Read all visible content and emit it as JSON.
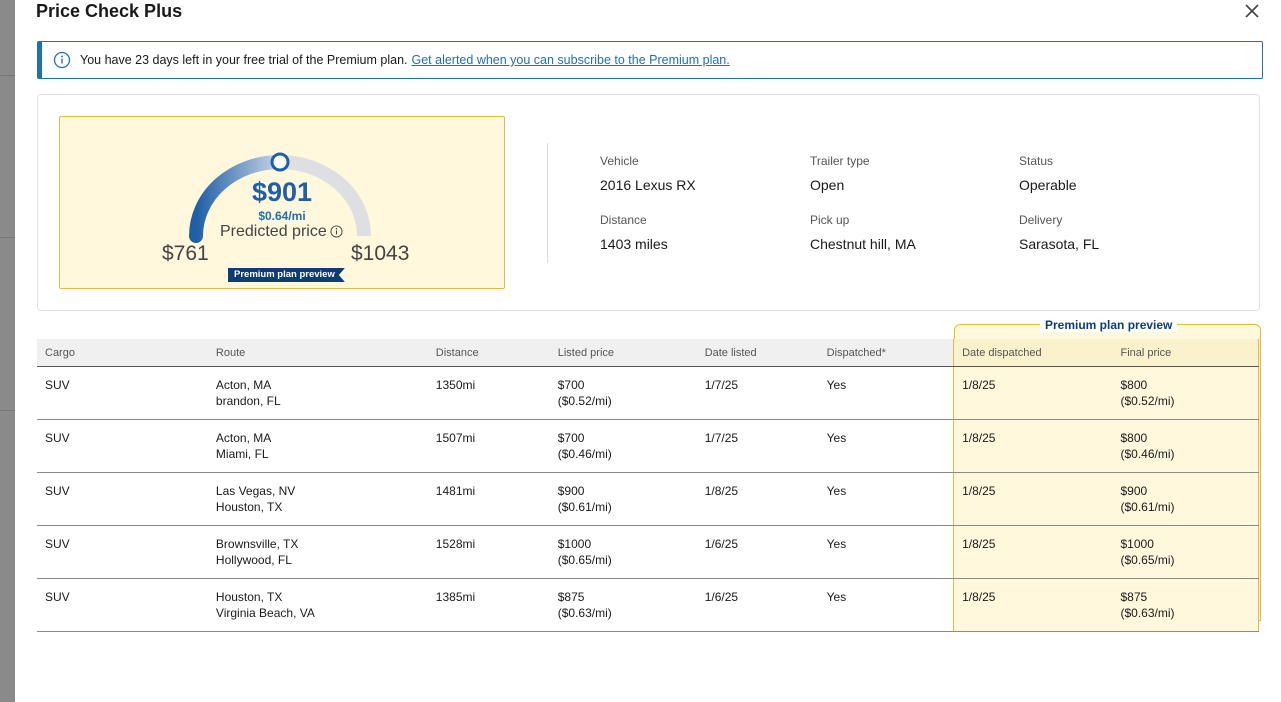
{
  "modal": {
    "title": "Price Check Plus"
  },
  "banner": {
    "text": "You have 23 days left in your free trial of the Premium plan.",
    "link": "Get alerted when you can subscribe to the Premium plan."
  },
  "gauge": {
    "price": "$901",
    "per_mile": "$0.64/mi",
    "label": "Predicted price",
    "min": "$761",
    "max": "$1043",
    "ribbon": "Premium plan preview",
    "position_fraction": 0.5
  },
  "details": {
    "vehicle_label": "Vehicle",
    "vehicle": "2016 Lexus RX",
    "trailer_label": "Trailer type",
    "trailer": "Open",
    "status_label": "Status",
    "status": "Operable",
    "distance_label": "Distance",
    "distance": "1403 miles",
    "pickup_label": "Pick up",
    "pickup": "Chestnut hill, MA",
    "delivery_label": "Delivery",
    "delivery": "Sarasota, FL"
  },
  "table": {
    "premium_tag": "Premium plan preview",
    "headers": [
      "Cargo",
      "Route",
      "Distance",
      "Listed price",
      "Date listed",
      "Dispatched*",
      "Date dispatched",
      "Final price"
    ],
    "rows": [
      {
        "cargo": "SUV",
        "route_from": "Acton, MA",
        "route_to": "brandon, FL",
        "distance": "1350mi",
        "listed_price": "$700",
        "listed_per_mile": "($0.52/mi)",
        "date_listed": "1/7/25",
        "dispatched": "Yes",
        "date_dispatched": "1/8/25",
        "final_price": "$800",
        "final_per_mile": "($0.52/mi)"
      },
      {
        "cargo": "SUV",
        "route_from": "Acton, MA",
        "route_to": "Miami, FL",
        "distance": "1507mi",
        "listed_price": "$700",
        "listed_per_mile": "($0.46/mi)",
        "date_listed": "1/7/25",
        "dispatched": "Yes",
        "date_dispatched": "1/8/25",
        "final_price": "$800",
        "final_per_mile": "($0.46/mi)"
      },
      {
        "cargo": "SUV",
        "route_from": "Las Vegas, NV",
        "route_to": "Houston, TX",
        "distance": "1481mi",
        "listed_price": "$900",
        "listed_per_mile": "($0.61/mi)",
        "date_listed": "1/8/25",
        "dispatched": "Yes",
        "date_dispatched": "1/8/25",
        "final_price": "$900",
        "final_per_mile": "($0.61/mi)"
      },
      {
        "cargo": "SUV",
        "route_from": "Brownsville, TX",
        "route_to": "Hollywood, FL",
        "distance": "1528mi",
        "listed_price": "$1000",
        "listed_per_mile": "($0.65/mi)",
        "date_listed": "1/6/25",
        "dispatched": "Yes",
        "date_dispatched": "1/8/25",
        "final_price": "$1000",
        "final_per_mile": "($0.65/mi)"
      },
      {
        "cargo": "SUV",
        "route_from": "Houston, TX",
        "route_to": "Virginia Beach, VA",
        "distance": "1385mi",
        "listed_price": "$875",
        "listed_per_mile": "($0.63/mi)",
        "date_listed": "1/6/25",
        "dispatched": "Yes",
        "date_dispatched": "1/8/25",
        "final_price": "$875",
        "final_per_mile": "($0.63/mi)"
      }
    ]
  },
  "colors": {
    "accent": "#1f6fb2",
    "premium_bg": "#fff8dd",
    "premium_border": "#e6b84a",
    "ribbon": "#0d3d73"
  }
}
